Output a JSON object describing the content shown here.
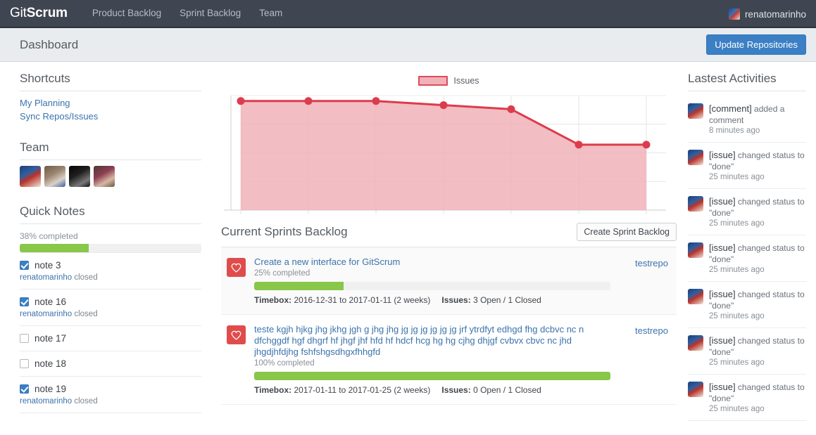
{
  "navbar": {
    "brand_light": "Git",
    "brand_bold": "Scrum",
    "links": [
      {
        "label": "Product Backlog"
      },
      {
        "label": "Sprint Backlog"
      },
      {
        "label": "Team"
      }
    ],
    "user": "renatomarinho",
    "user_avatar_icon": "user-avatar-icon"
  },
  "subheader": {
    "title": "Dashboard",
    "update_button": "Update Repositories"
  },
  "sidebar": {
    "shortcuts_title": "Shortcuts",
    "shortcuts": [
      {
        "label": "My Planning"
      },
      {
        "label": "Sync Repos/Issues"
      }
    ],
    "team_title": "Team",
    "team_avatars": [
      {
        "name": "team-avatar-1"
      },
      {
        "name": "team-avatar-2"
      },
      {
        "name": "team-avatar-3"
      },
      {
        "name": "team-avatar-4"
      }
    ],
    "quick_notes_title": "Quick Notes",
    "quick_notes_progress_label": "38% completed",
    "quick_notes_progress_pct": 38,
    "notes": [
      {
        "label": "note 3",
        "checked": true,
        "author": "renatomarinho",
        "status": "closed"
      },
      {
        "label": "note 16",
        "checked": true,
        "author": "renatomarinho",
        "status": "closed"
      },
      {
        "label": "note 17",
        "checked": false,
        "author": "",
        "status": ""
      },
      {
        "label": "note 18",
        "checked": false,
        "author": "",
        "status": ""
      },
      {
        "label": "note 19",
        "checked": true,
        "author": "renatomarinho",
        "status": "closed"
      }
    ]
  },
  "chart_data": {
    "type": "area",
    "title": "",
    "xlabel": "",
    "ylabel": "",
    "legend": [
      "Issues"
    ],
    "legend_position": "top-center",
    "grid": true,
    "series": [
      {
        "name": "Issues",
        "x": [
          0,
          1,
          2,
          3,
          4,
          5,
          6
        ],
        "values": [
          4,
          4,
          4,
          3.85,
          3.7,
          2.4,
          2.4
        ]
      }
    ],
    "ylim": [
      0,
      4.2
    ],
    "line_color": "#dc3c4c",
    "fill_color": "#f0b2b8",
    "point_color": "#dc3c4c"
  },
  "sprints": {
    "title": "Current Sprints Backlog",
    "create_button": "Create Sprint Backlog",
    "timebox_label": "Timebox:",
    "issues_label": "Issues:",
    "items": [
      {
        "name": "Create a new interface for GitScrum",
        "pct_label": "25% completed",
        "pct": 25,
        "timebox": "2016-12-31 to 2017-01-11 (2 weeks)",
        "issues": "3 Open / 1 Closed",
        "repo": "testrepo",
        "favorite_icon": "heart-icon"
      },
      {
        "name": "teste kgjh hjkg jhg jkhg jgh g jhg jhg jg jg jg jg jg jg jrf ytrdfyt edhgd fhg dcbvc nc n dfchggdf hgf dhgrf hf jhgf jhf hfd hf hdcf hcg hg hg cjhg dhjgf cvbvx cbvc nc jhd jhgdjhfdjhg fshfshgsdhgxfhhgfd",
        "pct_label": "100% completed",
        "pct": 100,
        "timebox": "2017-01-11 to 2017-01-25 (2 weeks)",
        "issues": "0 Open / 1 Closed",
        "repo": "testrepo",
        "favorite_icon": "heart-icon"
      }
    ]
  },
  "activities": {
    "title": "Lastest Activities",
    "items": [
      {
        "subject": "[comment]",
        "text": " added a comment",
        "time": "8 minutes ago"
      },
      {
        "subject": "[issue]",
        "text": " changed status to \"done\"",
        "time": "25 minutes ago"
      },
      {
        "subject": "[issue]",
        "text": " changed status to \"done\"",
        "time": "25 minutes ago"
      },
      {
        "subject": "[issue]",
        "text": " changed status to \"done\"",
        "time": "25 minutes ago"
      },
      {
        "subject": "[issue]",
        "text": " changed status to \"done\"",
        "time": "25 minutes ago"
      },
      {
        "subject": "[issue]",
        "text": " changed status to \"done\"",
        "time": "25 minutes ago"
      },
      {
        "subject": "[issue]",
        "text": " changed status to \"done\"",
        "time": "25 minutes ago"
      }
    ]
  },
  "colors": {
    "navbar_bg": "#3f4651",
    "primary_button": "#3b7fc4",
    "link": "#3b73ac",
    "progress_green": "#88c74a",
    "chart_line": "#dc3c4c",
    "chart_fill": "#f0b2b8",
    "heart_red": "#e04c4c"
  }
}
